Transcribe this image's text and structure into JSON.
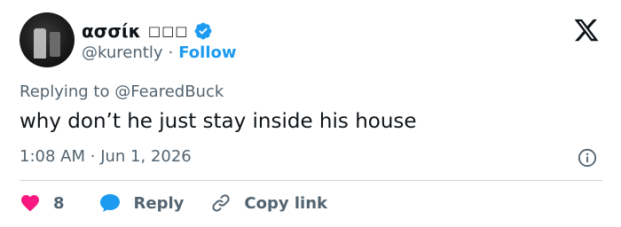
{
  "author": {
    "display_name": "ασσίκ",
    "display_name_extra": "□□□",
    "handle": "@kurently",
    "separator": "·",
    "follow_label": "Follow",
    "verified_color": "#1d9bf0"
  },
  "reply_context": {
    "prefix": "Replying to",
    "mention": "@FearedBuck"
  },
  "tweet": {
    "text": "why don’t he just stay inside his house",
    "time": "1:08 AM",
    "separator": "·",
    "date": "Jun 1, 2026"
  },
  "actions": {
    "like_count": "8",
    "reply_label": "Reply",
    "copy_label": "Copy link"
  },
  "colors": {
    "accent": "#1d9bf0",
    "like": "#f91880",
    "text_secondary": "#536471",
    "text_primary": "#0f1419"
  },
  "icons": [
    "verified-badge-icon",
    "x-logo-icon",
    "info-icon",
    "heart-icon",
    "reply-bubble-icon",
    "link-icon"
  ]
}
